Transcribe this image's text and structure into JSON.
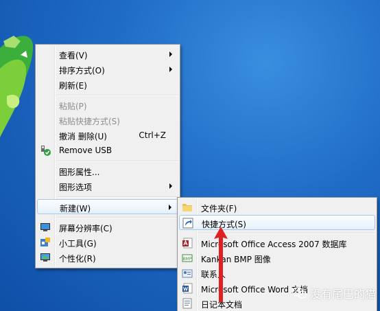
{
  "colors": {
    "menu_bg": "#f0f0f0",
    "highlight": "#e6f0fa",
    "highlight_border": "#a8c8eb",
    "disabled_text": "#8d8d8d",
    "arrow_red": "#e02020",
    "desktop_blue": "#1f6cc6"
  },
  "context_menu": {
    "items": [
      {
        "label": "查看(V)",
        "submenu": true
      },
      {
        "label": "排序方式(O)",
        "submenu": true
      },
      {
        "label": "刷新(E)"
      },
      {
        "label": "粘贴(P)",
        "disabled": true
      },
      {
        "label": "粘贴快捷方式(S)",
        "disabled": true
      },
      {
        "label": "撤消 删除(U)",
        "shortcut": "Ctrl+Z"
      },
      {
        "label": "Remove USB",
        "icon": "usb-shield-icon"
      },
      {
        "label": "图形属性...",
        "icon": "none"
      },
      {
        "label": "图形选项",
        "submenu": true
      },
      {
        "label": "新建(W)",
        "submenu": true,
        "highlighted": true
      },
      {
        "label": "屏幕分辨率(C)",
        "icon": "monitor-icon"
      },
      {
        "label": "小工具(G)",
        "icon": "gadgets-icon"
      },
      {
        "label": "个性化(R)",
        "icon": "personalize-icon"
      }
    ]
  },
  "new_submenu": {
    "items": [
      {
        "label": "文件夹(F)",
        "icon": "folder-icon"
      },
      {
        "label": "快捷方式(S)",
        "icon": "shortcut-icon",
        "highlighted": true
      },
      {
        "label": "Microsoft Office Access 2007 数据库",
        "icon": "access-icon"
      },
      {
        "label": "Kankan BMP 图像",
        "icon": "bmp-image-icon"
      },
      {
        "label": "联系人",
        "icon": "contact-icon"
      },
      {
        "label": "Microsoft Office Word 文档",
        "icon": "word-icon"
      },
      {
        "label": "日记本文档",
        "icon": "journal-icon"
      }
    ]
  },
  "watermark": {
    "text": "没有尾巴的猫"
  }
}
